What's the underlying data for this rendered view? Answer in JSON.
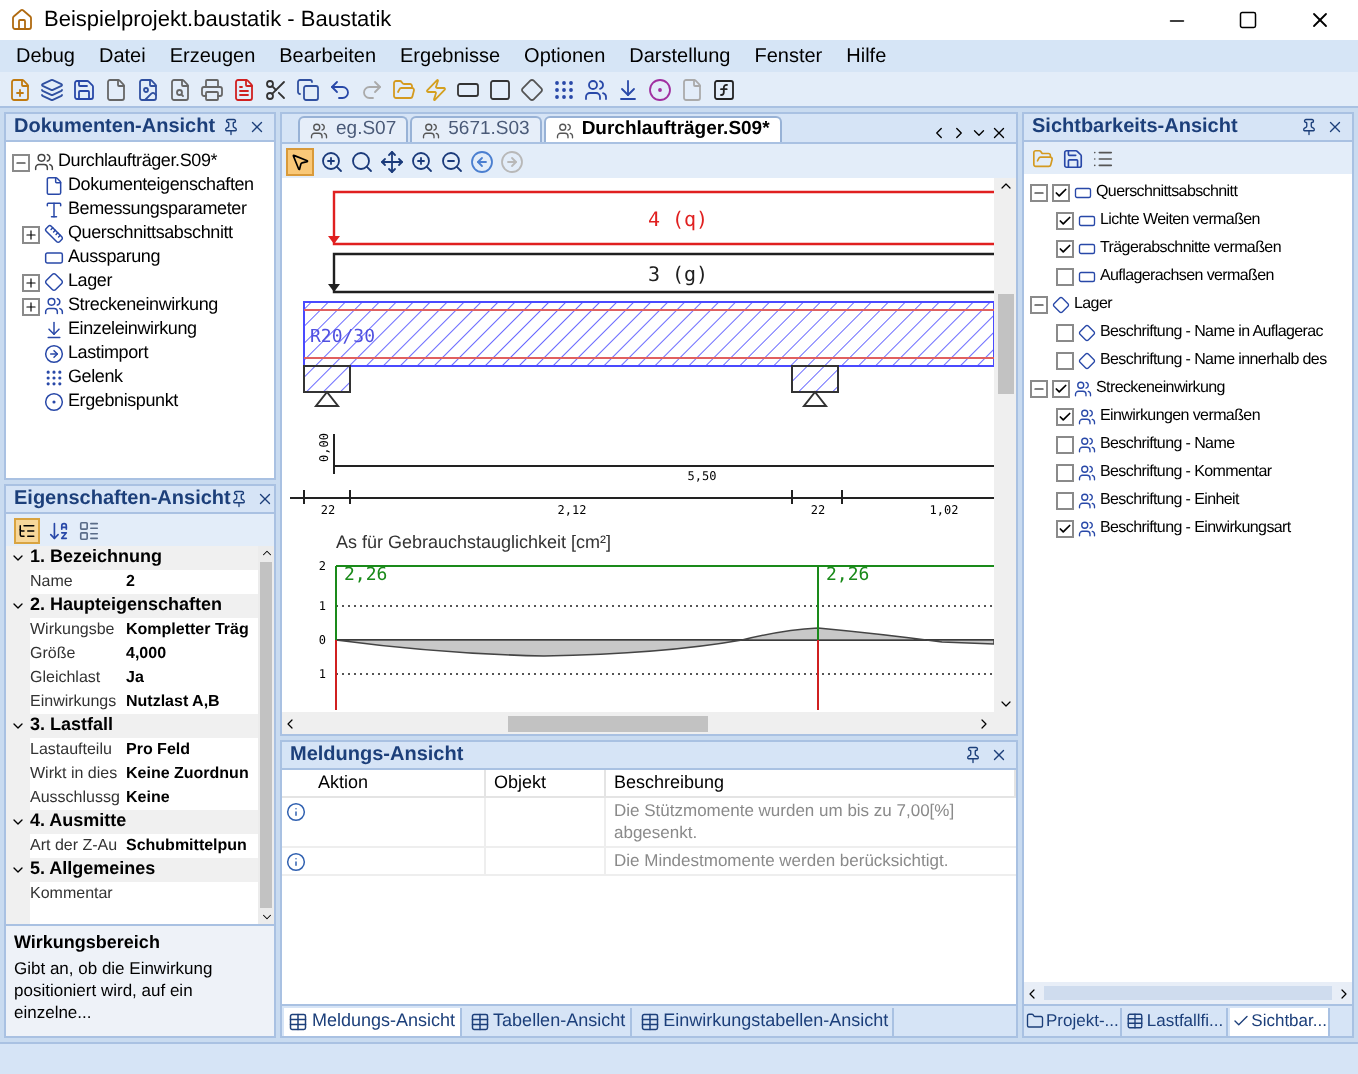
{
  "window": {
    "title": "Beispielprojekt.baustatik - Baustatik"
  },
  "menu": [
    "Debug",
    "Datei",
    "Erzeugen",
    "Bearbeiten",
    "Ergebnisse",
    "Optionen",
    "Darstellung",
    "Fenster",
    "Hilfe"
  ],
  "documents_panel": {
    "title": "Dokumenten-Ansicht",
    "tree": [
      {
        "label": "Durchlaufträger.S09*",
        "expanded": true,
        "children": [
          {
            "label": "Dokumenteigenschaften"
          },
          {
            "label": "Bemessungsparameter"
          },
          {
            "label": "Querschnittsabschnitt",
            "expanded": false
          },
          {
            "label": "Aussparung"
          },
          {
            "label": "Lager",
            "expanded": false
          },
          {
            "label": "Streckeneinwirkung",
            "expanded": false
          },
          {
            "label": "Einzeleinwirkung"
          },
          {
            "label": "Lastimport"
          },
          {
            "label": "Gelenk"
          },
          {
            "label": "Ergebnispunkt"
          }
        ]
      }
    ]
  },
  "properties_panel": {
    "title": "Eigenschaften-Ansicht",
    "groups": [
      {
        "label": "1. Bezeichnung",
        "expanded": true,
        "rows": [
          {
            "name": "Name",
            "value": "2"
          }
        ]
      },
      {
        "label": "2. Haupteigenschaften",
        "expanded": true,
        "rows": [
          {
            "name": "Wirkungsbe",
            "value": "Kompletter Träg"
          },
          {
            "name": "Größe",
            "value": "4,000"
          },
          {
            "name": "Gleichlast",
            "value": "Ja"
          },
          {
            "name": "Einwirkungs",
            "value": "Nutzlast A,B"
          }
        ]
      },
      {
        "label": "3. Lastfall",
        "expanded": true,
        "rows": [
          {
            "name": "Lastaufteilu",
            "value": "Pro Feld"
          },
          {
            "name": "Wirkt in dies",
            "value": "Keine Zuordnun"
          },
          {
            "name": "Ausschlussg",
            "value": "Keine"
          }
        ]
      },
      {
        "label": "4. Ausmitte",
        "expanded": true,
        "rows": [
          {
            "name": "Art der Z-Au",
            "value": "Schubmittelpun"
          }
        ]
      },
      {
        "label": "5. Allgemeines",
        "expanded": true,
        "rows": [
          {
            "name": "Kommentar"
          }
        ]
      }
    ],
    "description": {
      "title": "Wirkungsbereich",
      "text": "Gibt an, ob die Einwirkung positioniert wird, auf ein einzelne..."
    }
  },
  "document_tabs": [
    {
      "label": "eg.S07",
      "selected": false
    },
    {
      "label": "5671.S03",
      "selected": false
    },
    {
      "label": "Durchlaufträger.S09*",
      "selected": true
    }
  ],
  "drawing": {
    "loads": [
      {
        "label": "4 (q)",
        "color": "#e02020"
      },
      {
        "label": "3 (g)",
        "color": "#202020"
      }
    ],
    "section": "R20/30",
    "height_dim": "0,00",
    "span_dim": "5,50",
    "dims": [
      "22",
      "2,12",
      "22",
      "1,02"
    ],
    "diagram_title": "As für Gebrauchstauglichkeit [cm²]",
    "top_values": [
      "2,26",
      "2,26"
    ],
    "y_ticks": [
      "2",
      "1",
      "0",
      "1"
    ]
  },
  "messages_panel": {
    "title": "Meldungs-Ansicht",
    "columns": [
      "Aktion",
      "Objekt",
      "Beschreibung"
    ],
    "rows": [
      {
        "description": "Die Stützmomente wurden um bis zu 7,00[%] abgesenkt."
      },
      {
        "description": "Die Mindestmomente werden berücksichtigt."
      }
    ]
  },
  "bottom_tabs": [
    {
      "label": "Meldungs-Ansicht",
      "selected": true
    },
    {
      "label": "Tabellen-Ansicht",
      "selected": false
    },
    {
      "label": "Einwirkungstabellen-Ansicht",
      "selected": false
    }
  ],
  "visibility_panel": {
    "title": "Sichtbarkeits-Ansicht",
    "tree": [
      {
        "label": "Querschnittsabschnitt",
        "checked": true,
        "expanded": true,
        "children": [
          {
            "label": "Lichte Weiten vermaßen",
            "checked": true
          },
          {
            "label": "Trägerabschnitte vermaßen",
            "checked": true
          },
          {
            "label": "Auflagerachsen vermaßen",
            "checked": false
          }
        ]
      },
      {
        "label": "Lager",
        "expanded": true,
        "children": [
          {
            "label": "Beschriftung - Name in Auflagerac",
            "checked": false
          },
          {
            "label": "Beschriftung - Name innerhalb des",
            "checked": false
          }
        ]
      },
      {
        "label": "Streckeneinwirkung",
        "checked": true,
        "expanded": true,
        "children": [
          {
            "label": "Einwirkungen vermaßen",
            "checked": true
          },
          {
            "label": "Beschriftung - Name",
            "checked": false
          },
          {
            "label": "Beschriftung - Kommentar",
            "checked": false
          },
          {
            "label": "Beschriftung - Einheit",
            "checked": false
          },
          {
            "label": "Beschriftung - Einwirkungsart",
            "checked": true
          }
        ]
      }
    ]
  },
  "right_tabs": [
    {
      "label": "Projekt-...",
      "selected": false
    },
    {
      "label": "Lastfallfi...",
      "selected": false
    },
    {
      "label": "Sichtbar...",
      "selected": true
    }
  ]
}
